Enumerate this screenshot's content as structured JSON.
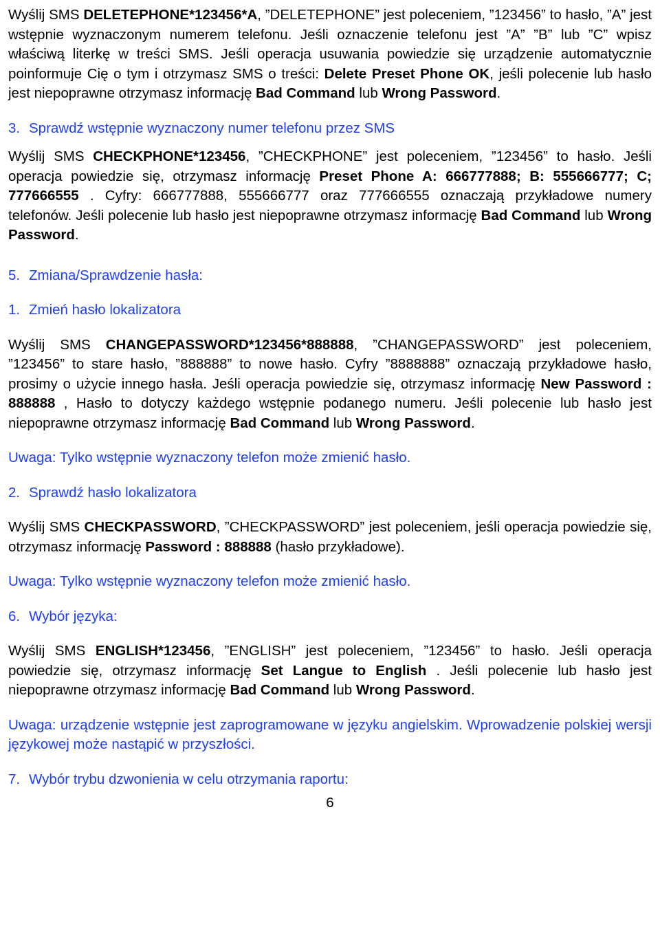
{
  "doc": {
    "page_number": "6",
    "para_delete_phone": {
      "p1_a": "Wyślij SMS ",
      "p1_b": "DELETEPHONE*123456*A",
      "p1_c": ", ”DELETEPHONE” jest poleceniem, ”123456” to hasło, ”A” jest wstępnie wyznaczonym numerem telefonu. Jeśli oznaczenie telefonu jest ”A” ”B” lub ”C” wpisz właściwą literkę w treści SMS. Jeśli operacja usuwania powiedzie się urządzenie automatycznie poinformuje Cię o tym i otrzymasz SMS o treści: ",
      "p1_d": "Delete Preset Phone OK",
      "p1_e": ", jeśli polecenie lub hasło jest niepoprawne otrzymasz informację ",
      "p1_f": "Bad Command",
      "p1_g": " lub ",
      "p1_h": "Wrong Password",
      "p1_i": "."
    },
    "item3": {
      "num": "3.",
      "label": "Sprawdź wstępnie wyznaczony numer telefonu przez SMS"
    },
    "para_checkphone": {
      "a": "Wyślij SMS ",
      "b": "CHECKPHONE*123456",
      "c": ", ”CHECKPHONE” jest poleceniem, ”123456” to hasło. Jeśli operacja powiedzie się, otrzymasz informację ",
      "d": "Preset Phone A: 666777888; B: 555666777; C; 777666555",
      "e": " . Cyfry: 666777888, 555666777 oraz 777666555 oznaczają przykładowe numery telefonów. Jeśli polecenie lub hasło jest niepoprawne otrzymasz informację ",
      "f": "Bad Command",
      "g": " lub ",
      "h": "Wrong Password",
      "i": "."
    },
    "section5": {
      "num": "5.",
      "label": "Zmiana/Sprawdzenie hasła:"
    },
    "item5_1": {
      "num": "1.",
      "label": "Zmień hasło lokalizatora"
    },
    "para_changepassword": {
      "a": "Wyślij SMS ",
      "b": "CHANGEPASSWORD*123456*888888",
      "c": ", ”CHANGEPASSWORD” jest poleceniem, ”123456” to stare hasło, ”888888” to nowe hasło. Cyfry ”8888888” oznaczają przykładowe hasło, prosimy o użycie innego hasła. Jeśli operacja powiedzie się, otrzymasz informację ",
      "d": "New Password : 888888",
      "e": " , Hasło to dotyczy każdego wstępnie podanego numeru. Jeśli polecenie lub hasło jest niepoprawne otrzymasz informację ",
      "f": "Bad Command",
      "g": " lub ",
      "h": "Wrong Password",
      "i": "."
    },
    "note1": "Uwaga: Tylko wstępnie wyznaczony telefon może zmienić hasło.",
    "item5_2": {
      "num": "2.",
      "label": "Sprawdź hasło lokalizatora"
    },
    "para_checkpassword": {
      "a": "Wyślij SMS ",
      "b": "CHECKPASSWORD",
      "c": ", ”CHECKPASSWORD” jest poleceniem, jeśli operacja powiedzie się, otrzymasz informację ",
      "d": "Password : 888888",
      "e": " (hasło przykładowe)."
    },
    "note2": "Uwaga: Tylko wstępnie wyznaczony telefon może zmienić hasło.",
    "section6": {
      "num": "6.",
      "label": "Wybór języka:"
    },
    "para_english": {
      "a": "Wyślij SMS ",
      "b": "ENGLISH*123456",
      "c": ", ”ENGLISH” jest poleceniem, ”123456” to hasło. Jeśli operacja powiedzie się, otrzymasz informację ",
      "d": "Set Langue to English",
      "e": " . Jeśli polecenie lub hasło jest niepoprawne otrzymasz informację ",
      "f": "Bad Command",
      "g": " lub ",
      "h": "Wrong Password",
      "i": "."
    },
    "note3": "Uwaga: urządzenie wstępnie jest zaprogramowane w języku angielskim. Wprowadzenie polskiej wersji językowej może nastąpić w przyszłości.",
    "section7": {
      "num": "7.",
      "label": "Wybór trybu dzwonienia w celu otrzymania raportu:"
    }
  }
}
